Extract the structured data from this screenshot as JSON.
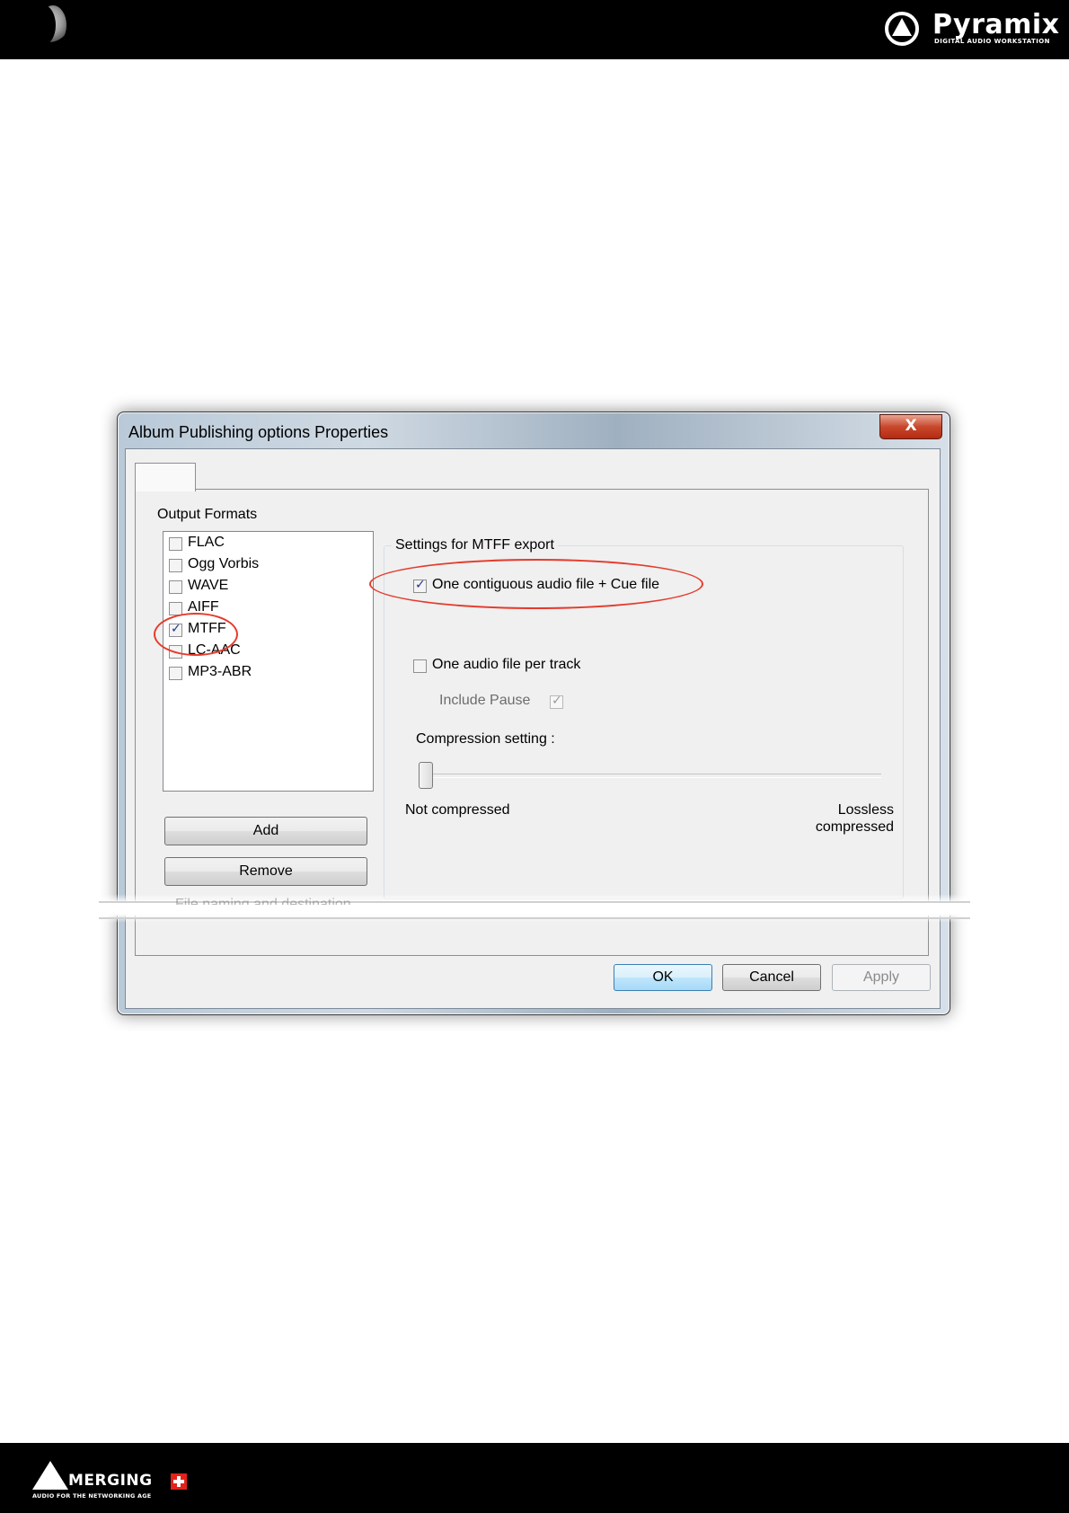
{
  "header": {
    "brand": "Pyramix",
    "tagline": "DIGITAL AUDIO WORKSTATION"
  },
  "footer": {
    "brand": "MERGING",
    "tagline": "AUDIO FOR THE NETWORKING AGE"
  },
  "dialog": {
    "title": "Album Publishing options Properties",
    "close_glyph": "X",
    "output_formats_label": "Output Formats",
    "formats": [
      {
        "label": "FLAC",
        "checked": false
      },
      {
        "label": "Ogg Vorbis",
        "checked": false
      },
      {
        "label": "WAVE",
        "checked": false
      },
      {
        "label": "AIFF",
        "checked": false
      },
      {
        "label": "MTFF",
        "checked": true
      },
      {
        "label": "LC-AAC",
        "checked": false
      },
      {
        "label": "MP3-ABR",
        "checked": false
      }
    ],
    "add_label": "Add",
    "remove_label": "Remove",
    "file_naming_label": "File naming and destination",
    "settings": {
      "group_title": "Settings for MTFF export",
      "contiguous_label": "One contiguous audio file + Cue file",
      "contiguous_checked": true,
      "per_track_label": "One audio file per track",
      "per_track_checked": false,
      "include_pause_label": "Include Pause",
      "include_pause_checked": true,
      "compression_label": "Compression setting :",
      "compression_value": 0,
      "min_label": "Not compressed",
      "max_label_line1": "Lossless",
      "max_label_line2": "compressed"
    },
    "ok_label": "OK",
    "cancel_label": "Cancel",
    "apply_label": "Apply"
  },
  "colors": {
    "highlight_ellipse": "#e53b2c",
    "top_bar": "#000000",
    "footer_bar": "#000000"
  }
}
